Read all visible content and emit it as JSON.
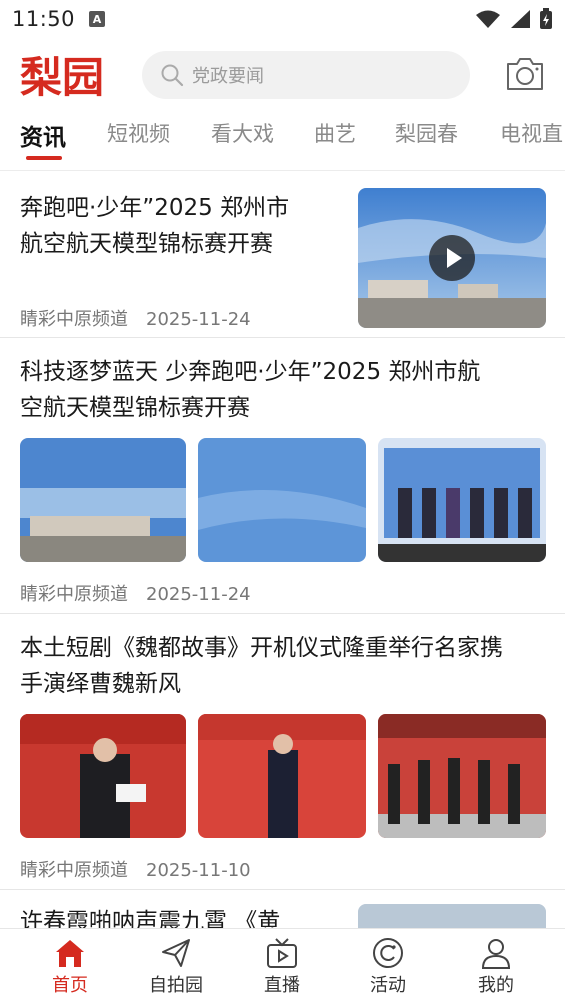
{
  "status": {
    "time": "11:50"
  },
  "header": {
    "logo_text": "梨园",
    "search_placeholder": "党政要闻"
  },
  "tabs": [
    {
      "label": "资讯"
    },
    {
      "label": "短视频"
    },
    {
      "label": "看大戏"
    },
    {
      "label": "曲艺"
    },
    {
      "label": "梨园春"
    },
    {
      "label": "电视直"
    }
  ],
  "articles": [
    {
      "title_l1": "奔跑吧·少年”2025 郑州市",
      "title_l2": "航空航天模型锦标赛开赛",
      "source": "睛彩中原频道",
      "date": "2025-11-24"
    },
    {
      "title_l1": "科技逐梦蓝天 少奔跑吧·少年”2025 郑州市航",
      "title_l2": "空航天模型锦标赛开赛",
      "source": "睛彩中原频道",
      "date": "2025-11-24"
    },
    {
      "title_l1": "本土短剧《魏都故事》开机仪式隆重举行名家携",
      "title_l2": "手演绎曹魏新风",
      "source": "睛彩中原频道",
      "date": "2025-11-10"
    },
    {
      "title_l1": "许春霞啪呐声震九霄 《黄"
    }
  ],
  "bottom_nav": [
    {
      "label": "首页"
    },
    {
      "label": "自拍园"
    },
    {
      "label": "直播"
    },
    {
      "label": "活动"
    },
    {
      "label": "我的"
    }
  ],
  "colors": {
    "accent": "#d52a1f",
    "text": "#1a1a1a",
    "muted": "#777777"
  }
}
